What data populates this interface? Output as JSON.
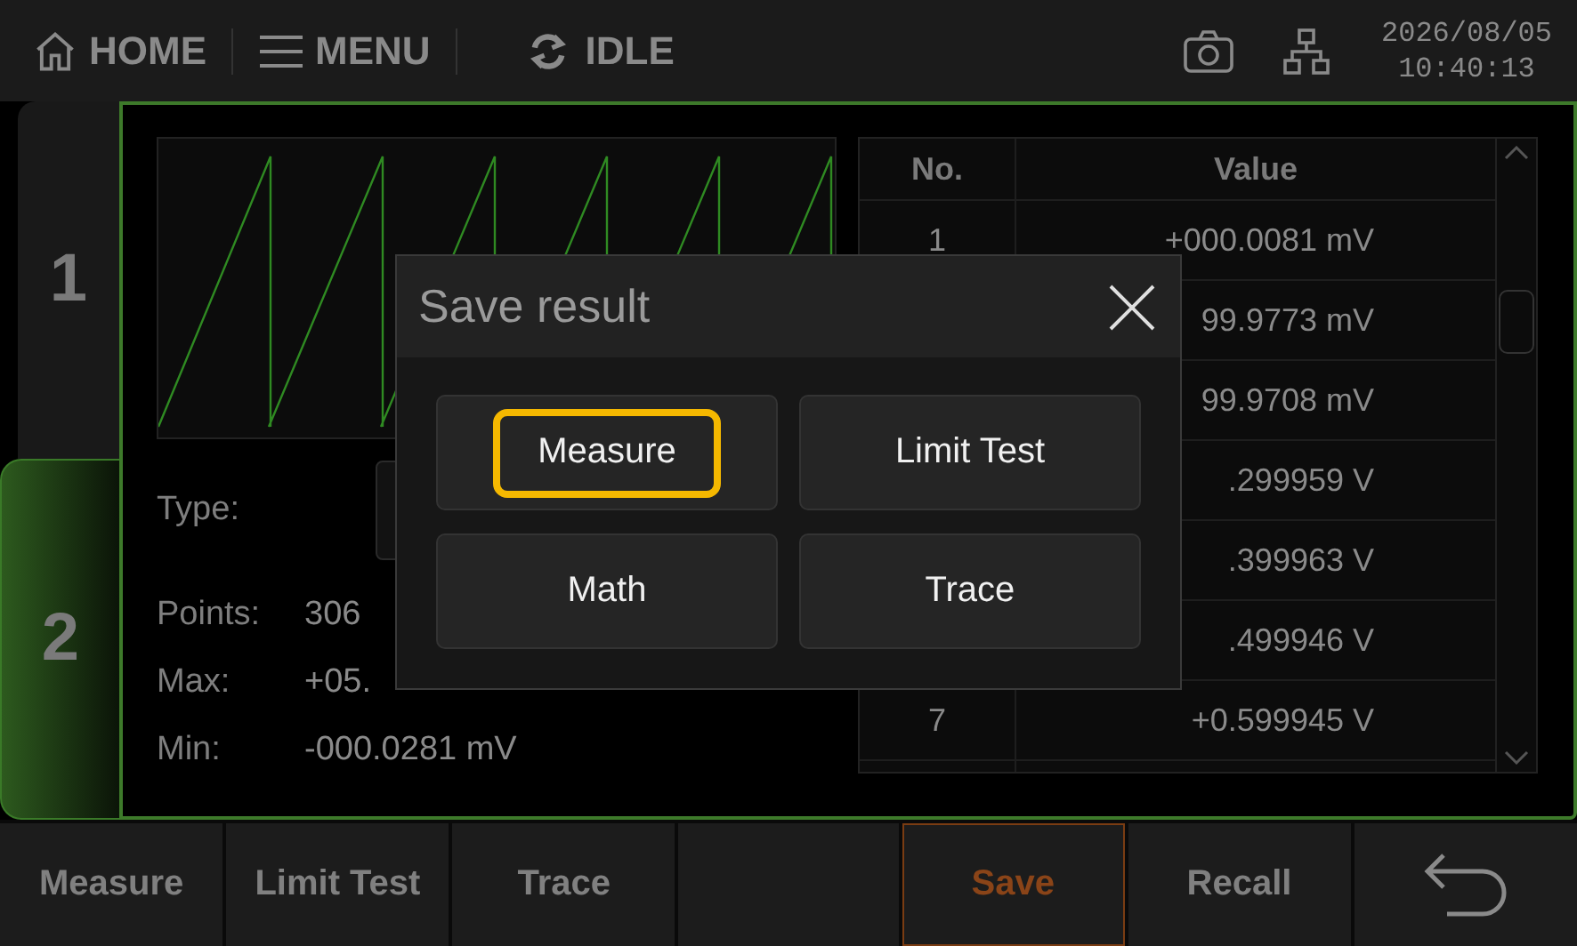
{
  "top_bar": {
    "home": "HOME",
    "menu": "MENU",
    "status": "IDLE",
    "date": "2026/08/05",
    "time": "10:40:13"
  },
  "side_tabs": [
    {
      "label": "1",
      "selected": false
    },
    {
      "label": "2",
      "selected": true
    }
  ],
  "info": {
    "type_label": "Type:",
    "points_label": "Points:",
    "points": "306",
    "max_label": "Max:",
    "max": "+05.",
    "min_label": "Min:",
    "min": "-000.0281 mV"
  },
  "table": {
    "columns": [
      "No.",
      "Value"
    ],
    "rows": [
      {
        "no": "1",
        "value": "+000.0081 mV"
      },
      {
        "no": "",
        "value": "99.9773 mV"
      },
      {
        "no": "",
        "value": "99.9708 mV"
      },
      {
        "no": "",
        "value": ".299959 V"
      },
      {
        "no": "",
        "value": ".399963 V"
      },
      {
        "no": "",
        "value": ".499946 V"
      },
      {
        "no": "7",
        "value": "+0.599945 V"
      }
    ]
  },
  "dialog": {
    "title": "Save result",
    "buttons": [
      {
        "label": "Measure",
        "focused": true
      },
      {
        "label": "Limit Test",
        "focused": false
      },
      {
        "label": "Math",
        "focused": false
      },
      {
        "label": "Trace",
        "focused": false
      }
    ]
  },
  "bottom_bar": [
    {
      "kind": "text",
      "label": "Measure",
      "selected": false
    },
    {
      "kind": "text",
      "label": "Limit Test",
      "selected": false
    },
    {
      "kind": "text",
      "label": "Trace",
      "selected": false
    },
    {
      "kind": "empty"
    },
    {
      "kind": "text",
      "label": "Save",
      "selected": true
    },
    {
      "kind": "text",
      "label": "Recall",
      "selected": false
    },
    {
      "kind": "back",
      "selected": false
    }
  ]
}
